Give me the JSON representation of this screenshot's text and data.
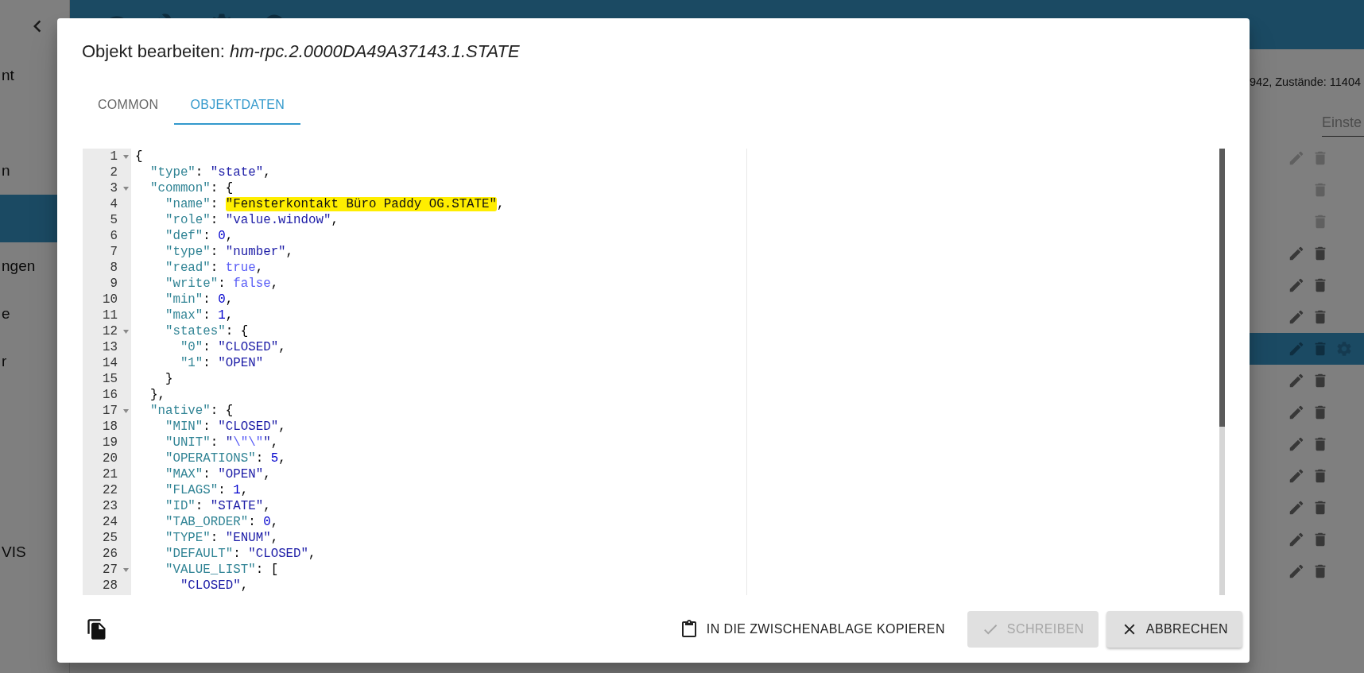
{
  "sidebar": {
    "items": [
      {
        "text": "nt",
        "selected": false
      },
      {
        "selected": false
      },
      {
        "text": "n",
        "selected": false
      },
      {
        "selected": true
      },
      {
        "text": "ngen",
        "selected": false
      },
      {
        "text": "e",
        "selected": false
      },
      {
        "text": "r",
        "selected": false
      },
      {
        "selected": false
      },
      {
        "selected": false
      },
      {
        "selected": false
      },
      {
        "text": "VIS",
        "selected": false
      }
    ]
  },
  "main": {
    "status": "942, Zustände: 11404",
    "filter": {
      "placeholder": "Einste"
    },
    "rows": [
      {
        "editable": true,
        "disabled": true,
        "selected": false
      },
      {
        "editable": false,
        "disabled": true,
        "selected": false
      },
      {
        "editable": false,
        "disabled": true,
        "selected": false
      },
      {
        "editable": true,
        "disabled": false,
        "selected": false
      },
      {
        "editable": true,
        "disabled": false,
        "selected": false
      },
      {
        "editable": true,
        "disabled": false,
        "selected": false
      },
      {
        "editable": true,
        "disabled": false,
        "selected": true
      },
      {
        "editable": true,
        "disabled": false,
        "selected": false
      },
      {
        "editable": true,
        "disabled": false,
        "selected": false
      },
      {
        "editable": true,
        "disabled": false,
        "selected": false
      },
      {
        "editable": true,
        "disabled": false,
        "selected": false
      },
      {
        "editable": true,
        "disabled": false,
        "selected": false
      },
      {
        "editable": true,
        "disabled": false,
        "selected": false
      },
      {
        "editable": true,
        "disabled": false,
        "selected": false
      }
    ]
  },
  "dialog": {
    "title": "Objekt bearbeiten: *hm-rpc.2.0000DA49A37143.1.STATE*",
    "tabs": [
      {
        "label": "COMMON",
        "selected": false
      },
      {
        "label": "OBJEKTDATEN",
        "selected": true
      }
    ],
    "editor": {
      "lines": [
        {
          "number": "1",
          "foldable": true,
          "tokens": [
            {
              "kind": "punct",
              "text": "{"
            }
          ]
        },
        {
          "number": "2",
          "foldable": false,
          "tokens": [
            {
              "kind": "key",
              "text": "  \"type\""
            },
            {
              "kind": "punct",
              "text": ": "
            },
            {
              "kind": "string",
              "text": "\"state\""
            },
            {
              "kind": "punct",
              "text": ","
            }
          ]
        },
        {
          "number": "3",
          "foldable": true,
          "tokens": [
            {
              "kind": "key",
              "text": "  \"common\""
            },
            {
              "kind": "punct",
              "text": ": {"
            }
          ]
        },
        {
          "number": "4",
          "foldable": false,
          "tokens": [
            {
              "kind": "key",
              "text": "    \"name\""
            },
            {
              "kind": "punct",
              "text": ": "
            },
            {
              "kind": "marked",
              "text": "\"Fensterkontakt Büro Paddy OG.STATE\""
            },
            {
              "kind": "punct",
              "text": ","
            }
          ]
        },
        {
          "number": "5",
          "foldable": false,
          "tokens": [
            {
              "kind": "key",
              "text": "    \"role\""
            },
            {
              "kind": "punct",
              "text": ": "
            },
            {
              "kind": "string",
              "text": "\"value.window\""
            },
            {
              "kind": "punct",
              "text": ","
            }
          ]
        },
        {
          "number": "6",
          "foldable": false,
          "tokens": [
            {
              "kind": "key",
              "text": "    \"def\""
            },
            {
              "kind": "punct",
              "text": ": "
            },
            {
              "kind": "number",
              "text": "0"
            },
            {
              "kind": "punct",
              "text": ","
            }
          ]
        },
        {
          "number": "7",
          "foldable": false,
          "tokens": [
            {
              "kind": "key",
              "text": "    \"type\""
            },
            {
              "kind": "punct",
              "text": ": "
            },
            {
              "kind": "string",
              "text": "\"number\""
            },
            {
              "kind": "punct",
              "text": ","
            }
          ]
        },
        {
          "number": "8",
          "foldable": false,
          "tokens": [
            {
              "kind": "key",
              "text": "    \"read\""
            },
            {
              "kind": "punct",
              "text": ": "
            },
            {
              "kind": "bool",
              "text": "true"
            },
            {
              "kind": "punct",
              "text": ","
            }
          ]
        },
        {
          "number": "9",
          "foldable": false,
          "tokens": [
            {
              "kind": "key",
              "text": "    \"write\""
            },
            {
              "kind": "punct",
              "text": ": "
            },
            {
              "kind": "bool",
              "text": "false"
            },
            {
              "kind": "punct",
              "text": ","
            }
          ]
        },
        {
          "number": "10",
          "foldable": false,
          "tokens": [
            {
              "kind": "key",
              "text": "    \"min\""
            },
            {
              "kind": "punct",
              "text": ": "
            },
            {
              "kind": "number",
              "text": "0"
            },
            {
              "kind": "punct",
              "text": ","
            }
          ]
        },
        {
          "number": "11",
          "foldable": false,
          "tokens": [
            {
              "kind": "key",
              "text": "    \"max\""
            },
            {
              "kind": "punct",
              "text": ": "
            },
            {
              "kind": "number",
              "text": "1"
            },
            {
              "kind": "punct",
              "text": ","
            }
          ]
        },
        {
          "number": "12",
          "foldable": true,
          "tokens": [
            {
              "kind": "key",
              "text": "    \"states\""
            },
            {
              "kind": "punct",
              "text": ": {"
            }
          ]
        },
        {
          "number": "13",
          "foldable": false,
          "tokens": [
            {
              "kind": "key",
              "text": "      \"0\""
            },
            {
              "kind": "punct",
              "text": ": "
            },
            {
              "kind": "string",
              "text": "\"CLOSED\""
            },
            {
              "kind": "punct",
              "text": ","
            }
          ]
        },
        {
          "number": "14",
          "foldable": false,
          "tokens": [
            {
              "kind": "key",
              "text": "      \"1\""
            },
            {
              "kind": "punct",
              "text": ": "
            },
            {
              "kind": "string",
              "text": "\"OPEN\""
            }
          ]
        },
        {
          "number": "15",
          "foldable": false,
          "tokens": [
            {
              "kind": "punct",
              "text": "    }"
            }
          ]
        },
        {
          "number": "16",
          "foldable": false,
          "tokens": [
            {
              "kind": "punct",
              "text": "  },"
            }
          ]
        },
        {
          "number": "17",
          "foldable": true,
          "tokens": [
            {
              "kind": "key",
              "text": "  \"native\""
            },
            {
              "kind": "punct",
              "text": ": {"
            }
          ]
        },
        {
          "number": "18",
          "foldable": false,
          "tokens": [
            {
              "kind": "key",
              "text": "    \"MIN\""
            },
            {
              "kind": "punct",
              "text": ": "
            },
            {
              "kind": "string",
              "text": "\"CLOSED\""
            },
            {
              "kind": "punct",
              "text": ","
            }
          ]
        },
        {
          "number": "19",
          "foldable": false,
          "tokens": [
            {
              "kind": "key",
              "text": "    \"UNIT\""
            },
            {
              "kind": "punct",
              "text": ": "
            },
            {
              "kind": "string",
              "text": "\""
            },
            {
              "kind": "escape",
              "text": "\\\"\\\""
            },
            {
              "kind": "string",
              "text": "\""
            },
            {
              "kind": "punct",
              "text": ","
            }
          ]
        },
        {
          "number": "20",
          "foldable": false,
          "tokens": [
            {
              "kind": "key",
              "text": "    \"OPERATIONS\""
            },
            {
              "kind": "punct",
              "text": ": "
            },
            {
              "kind": "number",
              "text": "5"
            },
            {
              "kind": "punct",
              "text": ","
            }
          ]
        },
        {
          "number": "21",
          "foldable": false,
          "tokens": [
            {
              "kind": "key",
              "text": "    \"MAX\""
            },
            {
              "kind": "punct",
              "text": ": "
            },
            {
              "kind": "string",
              "text": "\"OPEN\""
            },
            {
              "kind": "punct",
              "text": ","
            }
          ]
        },
        {
          "number": "22",
          "foldable": false,
          "tokens": [
            {
              "kind": "key",
              "text": "    \"FLAGS\""
            },
            {
              "kind": "punct",
              "text": ": "
            },
            {
              "kind": "number",
              "text": "1"
            },
            {
              "kind": "punct",
              "text": ","
            }
          ]
        },
        {
          "number": "23",
          "foldable": false,
          "tokens": [
            {
              "kind": "key",
              "text": "    \"ID\""
            },
            {
              "kind": "punct",
              "text": ": "
            },
            {
              "kind": "string",
              "text": "\"STATE\""
            },
            {
              "kind": "punct",
              "text": ","
            }
          ]
        },
        {
          "number": "24",
          "foldable": false,
          "tokens": [
            {
              "kind": "key",
              "text": "    \"TAB_ORDER\""
            },
            {
              "kind": "punct",
              "text": ": "
            },
            {
              "kind": "number",
              "text": "0"
            },
            {
              "kind": "punct",
              "text": ","
            }
          ]
        },
        {
          "number": "25",
          "foldable": false,
          "tokens": [
            {
              "kind": "key",
              "text": "    \"TYPE\""
            },
            {
              "kind": "punct",
              "text": ": "
            },
            {
              "kind": "string",
              "text": "\"ENUM\""
            },
            {
              "kind": "punct",
              "text": ","
            }
          ]
        },
        {
          "number": "26",
          "foldable": false,
          "tokens": [
            {
              "kind": "key",
              "text": "    \"DEFAULT\""
            },
            {
              "kind": "punct",
              "text": ": "
            },
            {
              "kind": "string",
              "text": "\"CLOSED\""
            },
            {
              "kind": "punct",
              "text": ","
            }
          ]
        },
        {
          "number": "27",
          "foldable": true,
          "tokens": [
            {
              "kind": "key",
              "text": "    \"VALUE_LIST\""
            },
            {
              "kind": "punct",
              "text": ": ["
            }
          ]
        },
        {
          "number": "28",
          "foldable": false,
          "tokens": [
            {
              "kind": "string",
              "text": "      \"CLOSED\""
            },
            {
              "kind": "punct",
              "text": ","
            }
          ]
        }
      ]
    },
    "buttons": [
      {
        "kind": "clipboard",
        "label": "IN DIE ZWISCHENABLAGE KOPIEREN",
        "disabled": false
      },
      {
        "kind": "write",
        "label": "SCHREIBEN",
        "disabled": true
      },
      {
        "kind": "cancel",
        "label": "ABBRECHEN",
        "disabled": false
      }
    ]
  }
}
